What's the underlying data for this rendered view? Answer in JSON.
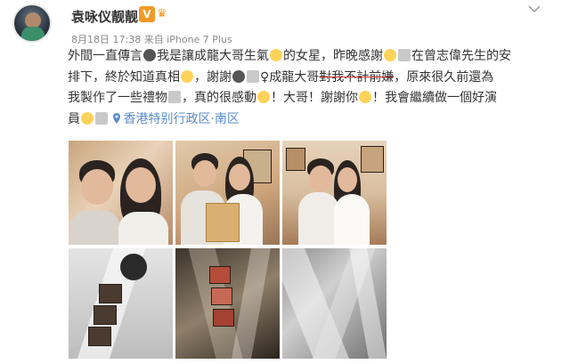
{
  "post": {
    "username": "袁咏仪靓靓",
    "vip_badge": "V",
    "meta": "8月18日 17:38 来自 iPhone 7 Plus",
    "text": {
      "l1a": "外間一直傳言",
      "l1b": "我是讓成龍大哥生氣",
      "l1c": "的女星，昨晚感謝",
      "l1d": "在曾志偉先生的安",
      "l2a": "排下，終於知道真相",
      "l2b": "，謝謝",
      "l2c": "成龍大哥",
      "l2d": "對我不計前嫌",
      "l2e": "，原來很久前還為",
      "l3a": "我製作了一些禮物",
      "l3b": "，真的很感動",
      "l3c": "！大哥！謝謝你",
      "l3d": "！我會繼續做一個好演",
      "l4a": "員"
    },
    "location": "香港特别行政区·南区",
    "icons": [
      "chevron-down-icon",
      "location-pin-icon",
      "emoji-icon"
    ],
    "colors": {
      "link": "#5b8dc9",
      "vip": "#f19a27",
      "meta": "#8a8a8a"
    }
  }
}
